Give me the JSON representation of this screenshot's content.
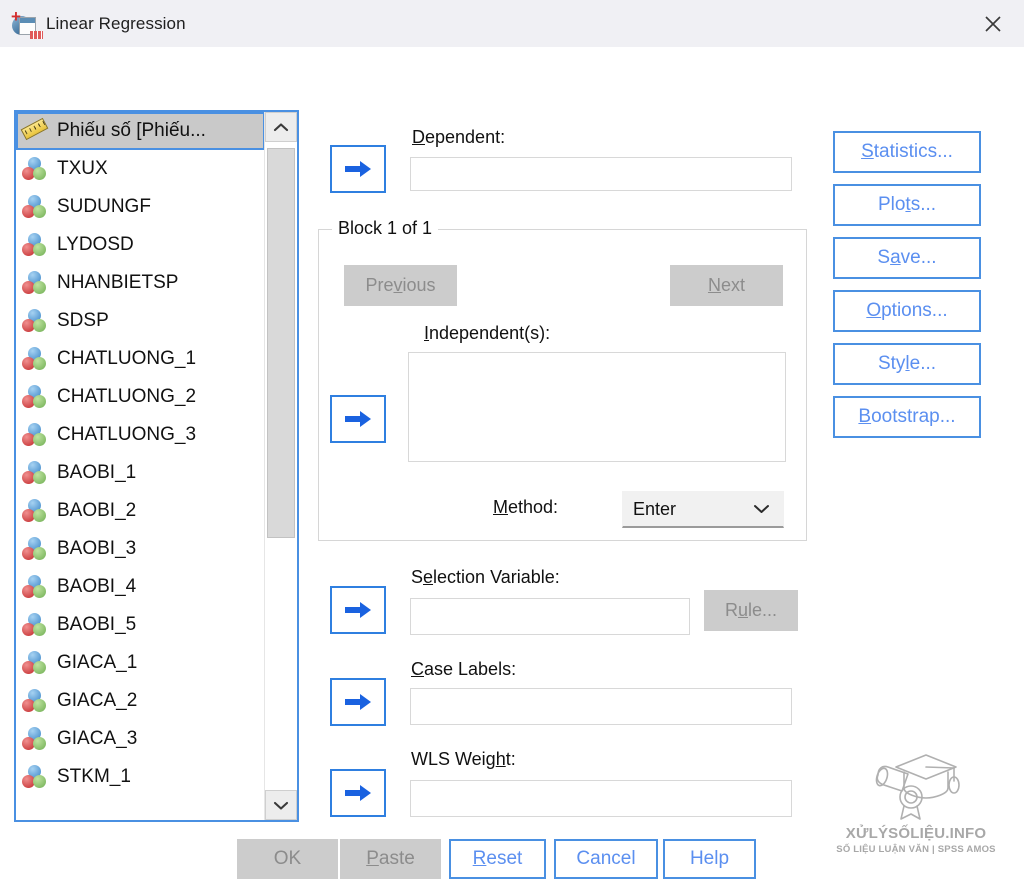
{
  "window": {
    "title": "Linear Regression",
    "icon": "spss-regression-icon",
    "close_label": "✕"
  },
  "variable_list": {
    "items": [
      {
        "label": "Phiếu số [Phiếu...",
        "icon": "scale-ruler-icon",
        "selected": true
      },
      {
        "label": "TXUX",
        "icon": "nominal-balls-icon",
        "selected": false
      },
      {
        "label": "SUDUNGF",
        "icon": "nominal-balls-icon",
        "selected": false
      },
      {
        "label": "LYDOSD",
        "icon": "nominal-balls-icon",
        "selected": false
      },
      {
        "label": "NHANBIETSP",
        "icon": "nominal-balls-icon",
        "selected": false
      },
      {
        "label": "SDSP",
        "icon": "nominal-balls-icon",
        "selected": false
      },
      {
        "label": "CHATLUONG_1",
        "icon": "nominal-balls-icon",
        "selected": false
      },
      {
        "label": "CHATLUONG_2",
        "icon": "nominal-balls-icon",
        "selected": false
      },
      {
        "label": "CHATLUONG_3",
        "icon": "nominal-balls-icon",
        "selected": false
      },
      {
        "label": "BAOBI_1",
        "icon": "nominal-balls-icon",
        "selected": false
      },
      {
        "label": "BAOBI_2",
        "icon": "nominal-balls-icon",
        "selected": false
      },
      {
        "label": "BAOBI_3",
        "icon": "nominal-balls-icon",
        "selected": false
      },
      {
        "label": "BAOBI_4",
        "icon": "nominal-balls-icon",
        "selected": false
      },
      {
        "label": "BAOBI_5",
        "icon": "nominal-balls-icon",
        "selected": false
      },
      {
        "label": "GIACA_1",
        "icon": "nominal-balls-icon",
        "selected": false
      },
      {
        "label": "GIACA_2",
        "icon": "nominal-balls-icon",
        "selected": false
      },
      {
        "label": "GIACA_3",
        "icon": "nominal-balls-icon",
        "selected": false
      },
      {
        "label": "STKM_1",
        "icon": "nominal-balls-icon",
        "selected": false
      }
    ]
  },
  "dependent": {
    "label_pre": "",
    "label_mnemonic": "D",
    "label_post": "ependent:",
    "value": "",
    "move_button": "move-to-dependent"
  },
  "block": {
    "legend": "Block 1 of 1",
    "previous": {
      "pre": "Pre",
      "mnemonic": "v",
      "post": "ious",
      "enabled": false
    },
    "next": {
      "pre": "",
      "mnemonic": "N",
      "post": "ext",
      "enabled": false
    },
    "independents": {
      "label_pre": "",
      "label_mnemonic": "I",
      "label_post": "ndependent(s):",
      "value": ""
    },
    "method": {
      "label_pre": "",
      "label_mnemonic": "M",
      "label_post": "ethod:",
      "selected": "Enter",
      "options": [
        "Enter"
      ]
    }
  },
  "selection_variable": {
    "label_pre": "S",
    "label_mnemonic": "e",
    "label_post": "lection Variable:",
    "value": "",
    "rule_button": {
      "pre": "R",
      "mnemonic": "u",
      "post": "le...",
      "enabled": false
    }
  },
  "case_labels": {
    "label_pre": "",
    "label_mnemonic": "C",
    "label_post": "ase Labels:",
    "value": ""
  },
  "wls_weight": {
    "label_pre": "WLS Weig",
    "label_mnemonic": "h",
    "label_post": "t:",
    "value": ""
  },
  "side_buttons": [
    {
      "pre": "",
      "mnemonic": "S",
      "post": "tatistics...",
      "name": "statistics"
    },
    {
      "pre": "Plo",
      "mnemonic": "t",
      "post": "s...",
      "name": "plots"
    },
    {
      "pre": "S",
      "mnemonic": "a",
      "post": "ve...",
      "name": "save"
    },
    {
      "pre": "",
      "mnemonic": "O",
      "post": "ptions...",
      "name": "options"
    },
    {
      "pre": "Sty",
      "mnemonic": "l",
      "post": "e...",
      "name": "style"
    },
    {
      "pre": "",
      "mnemonic": "B",
      "post": "ootstrap...",
      "name": "bootstrap"
    }
  ],
  "bottom_buttons": [
    {
      "pre": "OK",
      "mnemonic": "",
      "post": "",
      "name": "ok",
      "enabled": false
    },
    {
      "pre": "",
      "mnemonic": "P",
      "post": "aste",
      "name": "paste",
      "enabled": false
    },
    {
      "pre": "",
      "mnemonic": "R",
      "post": "eset",
      "name": "reset",
      "enabled": true
    },
    {
      "pre": "Cancel",
      "mnemonic": "",
      "post": "",
      "name": "cancel",
      "enabled": true
    },
    {
      "pre": "Help",
      "mnemonic": "",
      "post": "",
      "name": "help",
      "enabled": true
    }
  ],
  "watermark": {
    "title": "XỬLÝSỐLIỆU.INFO",
    "subtitle": "SỐ LIỆU LUẬN VĂN | SPSS AMOS"
  },
  "colors": {
    "accent_blue": "#4a90e2",
    "link_blue": "#5b8ff0",
    "arrow_blue": "#1a62e0",
    "disabled_gray": "#cccccc",
    "titlebar_bg": "#f0f0f4"
  }
}
